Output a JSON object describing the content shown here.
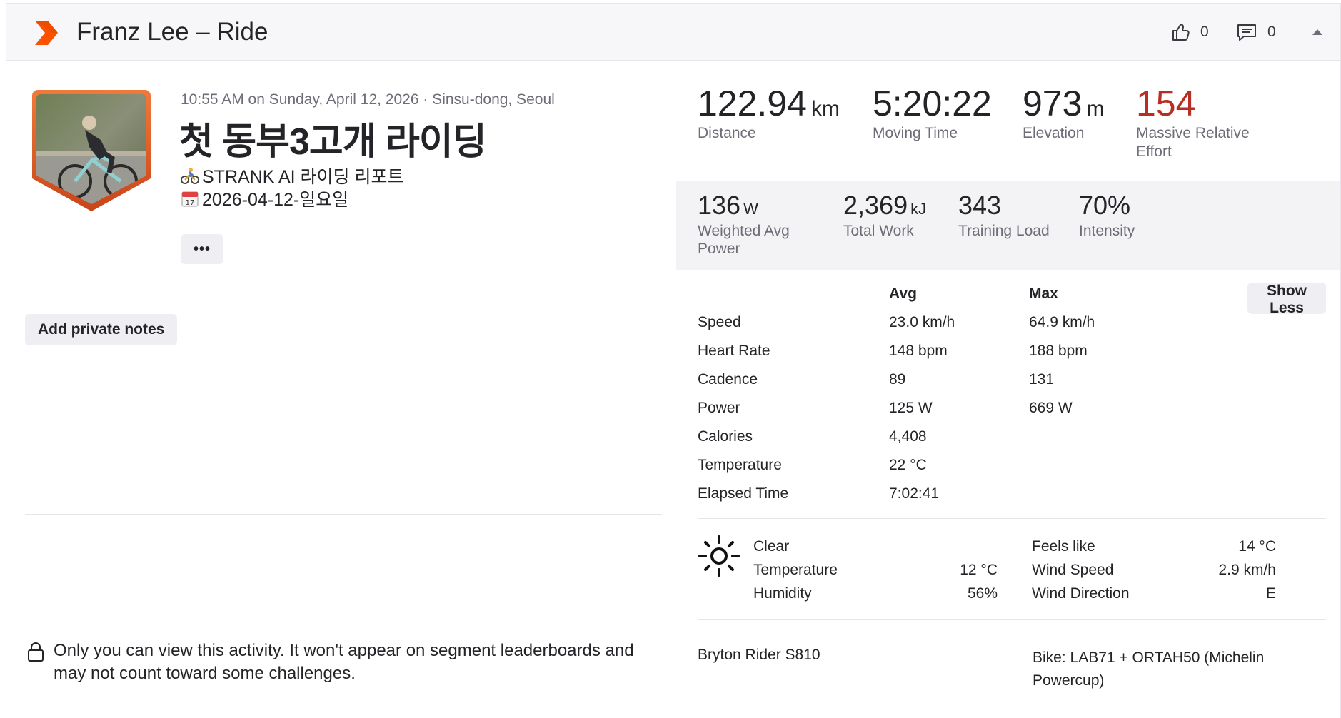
{
  "header": {
    "title": "Franz Lee – Ride",
    "kudos_count": "0",
    "comment_count": "0"
  },
  "activity": {
    "meta": "10:55 AM on Sunday, April 12, 2026 · Sinsu-dong, Seoul",
    "name": "첫 동부3고개 라이딩",
    "description_lines": [
      "STRANK AI 라이딩 리포트",
      "2026-04-12-일요일"
    ],
    "more_label": "•••",
    "notes_button": "Add private notes",
    "privacy_text": "Only you can view this activity. It won't appear on segment leaderboards and may not count toward some challenges."
  },
  "summary": [
    {
      "value": "122.94",
      "unit": "km",
      "label": "Distance"
    },
    {
      "value": "5:20:22",
      "unit": "",
      "label": "Moving Time"
    },
    {
      "value": "973",
      "unit": "m",
      "label": "Elevation"
    },
    {
      "value": "154",
      "unit": "",
      "label": "Massive Relative Effort"
    }
  ],
  "power": [
    {
      "value": "136",
      "unit": "W",
      "label": "Weighted Avg Power"
    },
    {
      "value": "2,369",
      "unit": "kJ",
      "label": "Total Work"
    },
    {
      "value": "343",
      "unit": "",
      "label": "Training Load"
    },
    {
      "value": "70%",
      "unit": "",
      "label": "Intensity"
    }
  ],
  "details": {
    "avg_header": "Avg",
    "max_header": "Max",
    "show_less": "Show Less",
    "rows": [
      {
        "name": "Speed",
        "avg": "23.0 km/h",
        "max": "64.9 km/h"
      },
      {
        "name": "Heart Rate",
        "avg": "148 bpm",
        "max": "188 bpm"
      },
      {
        "name": "Cadence",
        "avg": "89",
        "max": "131"
      },
      {
        "name": "Power",
        "avg": "125 W",
        "max": "669 W"
      },
      {
        "name": "Calories",
        "avg": "4,408",
        "max": ""
      },
      {
        "name": "Temperature",
        "avg": "22 °C",
        "max": ""
      },
      {
        "name": "Elapsed Time",
        "avg": "7:02:41",
        "max": ""
      }
    ]
  },
  "weather": {
    "icon": "sun-icon",
    "condition": "Clear",
    "left": [
      {
        "label": "Temperature",
        "value": "12 °C"
      },
      {
        "label": "Humidity",
        "value": "56%"
      }
    ],
    "right": [
      {
        "label": "Feels like",
        "value": "14 °C"
      },
      {
        "label": "Wind Speed",
        "value": "2.9 km/h"
      },
      {
        "label": "Wind Direction",
        "value": "E"
      }
    ]
  },
  "gear": {
    "device": "Bryton Rider S810",
    "bike": "Bike: LAB71 + ORTAH50 (Michelin Powercup)"
  },
  "colors": {
    "brand": "#fc5200",
    "effort": "#b82e25",
    "header_bg": "#f7f7fa",
    "band_bg": "#f3f3f6"
  }
}
